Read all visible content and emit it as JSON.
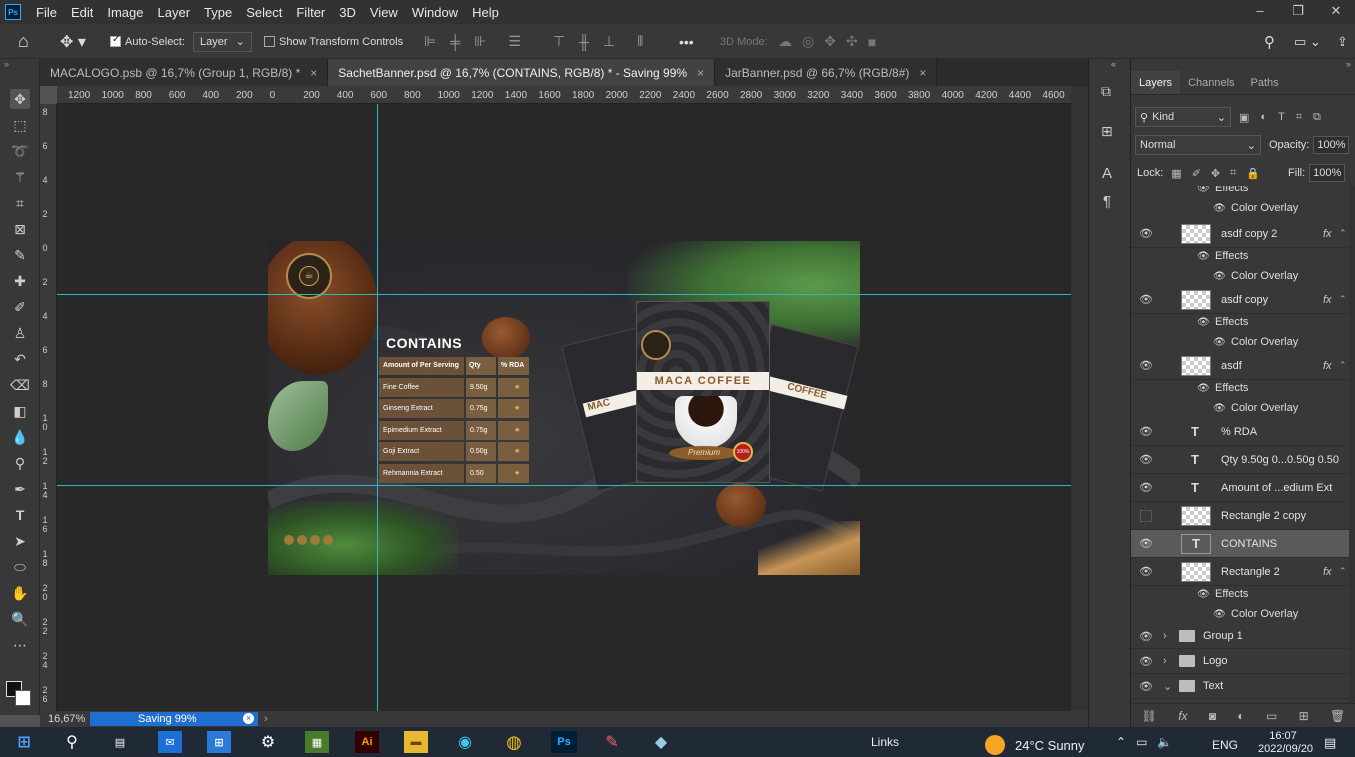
{
  "app": {
    "logo": "Ps",
    "menu": [
      "File",
      "Edit",
      "Image",
      "Layer",
      "Type",
      "Select",
      "Filter",
      "3D",
      "View",
      "Window",
      "Help"
    ]
  },
  "window_controls": {
    "minimize": "–",
    "restore": "❐",
    "close": "✕"
  },
  "options": {
    "auto_select_label": "Auto-Select:",
    "auto_select_value": "Layer",
    "show_transform_label": "Show Transform Controls",
    "more": "•••",
    "mode_3d": "3D Mode:"
  },
  "tabs": [
    {
      "label": "MACALOGO.psb @ 16,7% (Group 1, RGB/8) *",
      "close": "×"
    },
    {
      "label": "SachetBanner.psd @ 16,7% (CONTAINS, RGB/8) * - Saving 99%",
      "close": "×"
    },
    {
      "label": "JarBanner.psd @ 66,7% (RGB/8#)",
      "close": "×"
    }
  ],
  "ruler_h": [
    "1200",
    "1000",
    "800",
    "600",
    "400",
    "200",
    "0",
    "200",
    "400",
    "600",
    "800",
    "1000",
    "1200",
    "1400",
    "1600",
    "1800",
    "2000",
    "2200",
    "2400",
    "2600",
    "2800",
    "3000",
    "3200",
    "3400",
    "3600",
    "3800",
    "4000",
    "4200",
    "4400",
    "4600"
  ],
  "ruler_v": [
    "8",
    "6",
    "4",
    "2",
    "0",
    "2",
    "4",
    "6",
    "8",
    "1 0",
    "1 2",
    "1 4",
    "1 6",
    "1 8",
    "2 0",
    "2 2",
    "2 4",
    "2 6"
  ],
  "status": {
    "zoom": "16,67%",
    "saving": "Saving 99%"
  },
  "banner": {
    "logo_text": "MACA",
    "contains_title": "CONTAINS",
    "table_header": [
      "Amount of Per Serving",
      "Qty",
      "% RDA"
    ],
    "table_rows": [
      [
        "Fine Coffee",
        "9.50g",
        "★"
      ],
      [
        "Ginseng Extract",
        "0.75g",
        "★"
      ],
      [
        "Epimedium Extract",
        "0.75g",
        "★"
      ],
      [
        "Goji Extract",
        "0.50g",
        "★"
      ],
      [
        "Rehmannia Extract",
        "0.50",
        "★"
      ]
    ],
    "sachet_title": "MACA COFFEE",
    "sachet_left": "MAC",
    "sachet_right": "COFFEE",
    "premium": "Premium",
    "badge": "100%"
  },
  "panel": {
    "tabs": [
      "Layers",
      "Channels",
      "Paths"
    ],
    "filter_kind": "Kind",
    "blend_mode": "Normal",
    "opacity_label": "Opacity:",
    "opacity": "100%",
    "lock_label": "Lock:",
    "fill_label": "Fill:",
    "fill": "100%"
  },
  "layers": [
    {
      "name": "asdf copy 2",
      "type": "pixel",
      "fx": "fx"
    },
    {
      "name": "asdf copy",
      "type": "pixel",
      "fx": "fx"
    },
    {
      "name": "asdf",
      "type": "pixel",
      "fx": "fx"
    },
    {
      "name": "% RDA",
      "type": "text"
    },
    {
      "name": "Qty 9.50g 0...0.50g 0.50",
      "type": "text"
    },
    {
      "name": "Amount of ...edium Ext",
      "type": "text"
    },
    {
      "name": "Rectangle 2 copy",
      "type": "pixel"
    },
    {
      "name": "CONTAINS",
      "type": "text"
    },
    {
      "name": "Rectangle 2",
      "type": "pixel",
      "fx": "fx"
    },
    {
      "name": "Group 1",
      "type": "group"
    },
    {
      "name": "Logo",
      "type": "group"
    },
    {
      "name": "Text",
      "type": "group"
    }
  ],
  "effects_label": "Effects",
  "color_overlay_label": "Color Overlay",
  "taskbar": {
    "links": "Links",
    "weather": "24°C  Sunny",
    "lang": "ENG",
    "time": "16:07",
    "date": "2022/09/20"
  }
}
